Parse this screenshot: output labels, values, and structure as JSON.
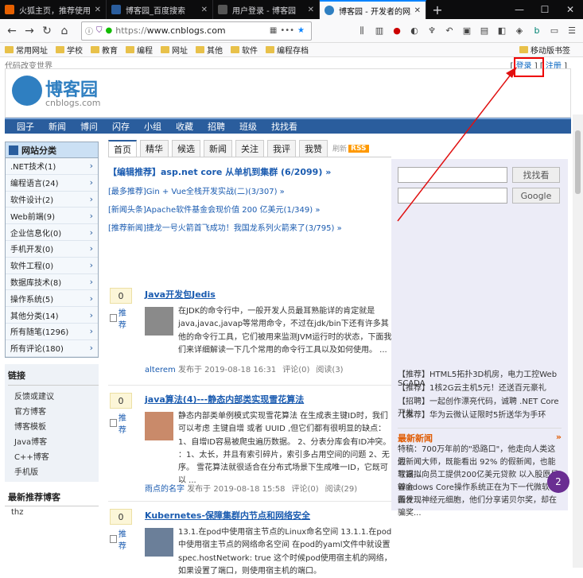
{
  "browser": {
    "tabs": [
      {
        "title": "火狐主页，推荐使用 F",
        "color": "#e66000",
        "active": false
      },
      {
        "title": "博客园_百度搜索",
        "color": "#2a5d9d",
        "active": false
      },
      {
        "title": "用户登录 - 博客园",
        "color": "#0c0c0d",
        "active": false
      },
      {
        "title": "博客园 - 开发者的网上",
        "color": "#2f7fc1",
        "active": true
      }
    ],
    "new_tab": "+",
    "url_prefix": "https://",
    "url_domain": "www.cnblogs.com",
    "bookmarks": [
      "常用网址",
      "学校",
      "教育",
      "编程",
      "网址",
      "其他",
      "软件",
      "编程存档"
    ],
    "mobile_bookmarks": "移动版书签"
  },
  "site": {
    "slogan": "代码改变世界",
    "login": "登录",
    "register": "注册",
    "logo_title": "博客园",
    "logo_sub": "cnblogs.com",
    "nav": [
      "园子",
      "新闻",
      "博问",
      "闪存",
      "小组",
      "收藏",
      "招聘",
      "班级",
      "找找看"
    ]
  },
  "categories": {
    "title": "网站分类",
    "items": [
      ".NET技术(1)",
      "编程语言(24)",
      "软件设计(2)",
      "Web前端(9)",
      "企业信息化(0)",
      "手机开发(0)",
      "软件工程(0)",
      "数据库技术(8)",
      "操作系统(5)",
      "其他分类(14)",
      "所有随笔(1296)",
      "所有评论(180)"
    ]
  },
  "links": {
    "title": "链接",
    "items": [
      "反馈或建议",
      "官方博客",
      "博客模板",
      "Java博客",
      "C++博客",
      "手机版"
    ]
  },
  "recommend": {
    "title": "最新推荐博客",
    "items": [
      "thz"
    ]
  },
  "content_tabs": {
    "items": [
      "首页",
      "精华",
      "候选",
      "新闻",
      "关注",
      "我评",
      "我赞"
    ],
    "refresh": "刷新",
    "rss": "RSS"
  },
  "editor_pick": "【编辑推荐】asp.net core 从单机到集群 (6/2099) »",
  "headlines": [
    "[最多推荐]Gin + Vue全栈开发实战(二)(3/307) »",
    "[新闻头条]Apache软件基金会现价值 200 亿美元(1/349) »",
    "[推荐新闻]捷龙一号火箭首飞成功！我国龙系列火箭来了(3/795) »"
  ],
  "posts": [
    {
      "votes": "0",
      "recommend": "推荐",
      "title": "Java开发包Jedis",
      "body": "在JDK的命令行中，一般开发人员最耳熟能详的肯定就是java,javac,javap等常用命令，不过在jdk/bin下还有许多其他的命令行工具，它们被用来监测JVM运行时的状态，下面我们来详细解读一下几个常用的命令行工具以及如何使用。 ...",
      "author": "alterem",
      "date": "发布于 2019-08-18 16:31",
      "comments": "评论(0)",
      "reads": "阅读(3)"
    },
    {
      "votes": "0",
      "recommend": "推荐",
      "title": "java算法(4)---静态内部类实现雪花算法",
      "body": "静态内部类单例模式实现雪花算法 在生成表主键ID时，我们可以考虑 主键自增 或者 UUID ,但它们都有很明显的缺点： 1、自增ID容易被爬虫遍历数据。 2、分表分库会有ID冲突。 ：1、太长，并且有索引碎片，索引多占用空间的问题 2、无序。 雪花算法就很适合在分布式场景下生成唯一ID，它既可以 ...",
      "author": "雨点的名字",
      "date": "发布于 2019-08-18 15:58",
      "comments": "评论(0)",
      "reads": "阅读(29)"
    },
    {
      "votes": "0",
      "recommend": "推荐",
      "title": "Kubernetes-保障集群内节点和网络安全",
      "body": "13.1.在pod中使用宿主节点的Linux命名空间 13.1.1.在pod中使用宿主节点的网络命名空间 在pod的yaml文件中就设置spec.hostNetwork: true 这个时候pod使用宿主机的网络，如果设置了端口，则使用宿主机的端口。"
    }
  ],
  "sidebar": {
    "search_button": "找找看",
    "google_button": "Google",
    "promos": [
      "【推荐】HTML5拓扑3D机房，电力工控Web SCADA",
      "【推荐】1核2G云主机5元！还送百元豪礼",
      "【招聘】一起创作漂亮代码，诚聘 .NET Core 开发",
      "【推荐】华为云微认证限时5折送华为手环"
    ],
    "news_title": "最新新闻",
    "news_more": "»",
    "news": [
      "特稿：700万年前的\"恐路口\"，他走向人类这边",
      "假新闻大师，既能看出 92% 的假新闻，也能写高...",
      "软银拟向员工提供200亿美元贷款 以入股愿景基金",
      "Windows Core操作系统正在为下一代微软设备什...",
      "因发现神经元细胞，他们分享诺贝尔奖，却在骗奖..."
    ]
  },
  "badge": "2"
}
